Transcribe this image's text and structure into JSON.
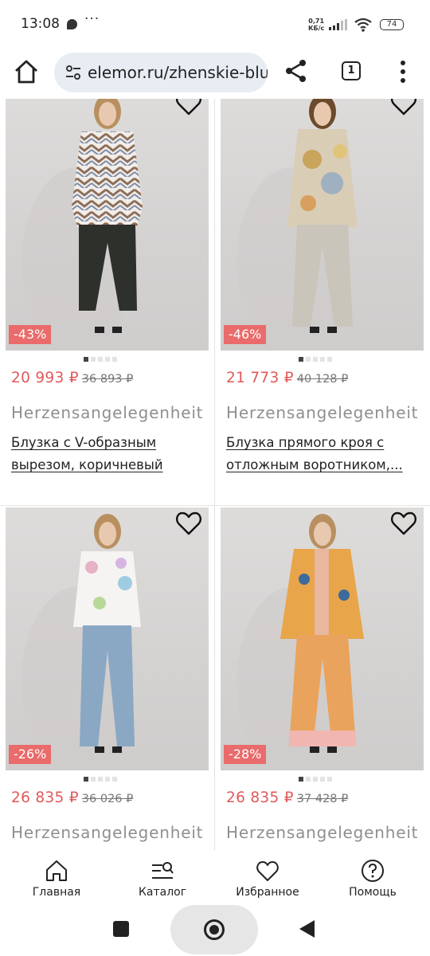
{
  "status_bar": {
    "time": "13:08",
    "more": "···",
    "net_speed_value": "0,71",
    "net_speed_unit": "КБ/с",
    "battery": "74"
  },
  "browser": {
    "url": "elemor.ru/zhenskie-bluzki",
    "tab_count": "1"
  },
  "products": [
    {
      "discount": "-43%",
      "price": "20 993 ₽",
      "old_price": "36 893 ₽",
      "brand": "Herzensangelegenheit",
      "title": "Блузка с V-образным вырезом, коричневый",
      "active_dot": 0,
      "dots": 5,
      "outfit": "chevron"
    },
    {
      "discount": "-46%",
      "price": "21 773 ₽",
      "old_price": "40 128 ₽",
      "brand": "Herzensangelegenheit",
      "title": "Блузка прямого кроя с отложным воротником,...",
      "active_dot": 0,
      "dots": 5,
      "outfit": "paisley"
    },
    {
      "discount": "-26%",
      "price": "26 835 ₽",
      "old_price": "36 026 ₽",
      "brand": "Herzensangelegenheit",
      "title": "",
      "active_dot": 0,
      "dots": 5,
      "outfit": "floral"
    },
    {
      "discount": "-28%",
      "price": "26 835 ₽",
      "old_price": "37 428 ₽",
      "brand": "Herzensangelegenheit",
      "title": "",
      "active_dot": 0,
      "dots": 5,
      "outfit": "orange"
    }
  ],
  "bottom_nav": [
    {
      "label": "Главная",
      "icon": "home-icon"
    },
    {
      "label": "Каталог",
      "icon": "catalog-search-icon"
    },
    {
      "label": "Избранное",
      "icon": "heart-icon"
    },
    {
      "label": "Помощь",
      "icon": "help-icon"
    }
  ],
  "colors": {
    "price": "#e05a5a",
    "discount_badge": "#e96b6b",
    "url_bar": "#e7edf3"
  }
}
